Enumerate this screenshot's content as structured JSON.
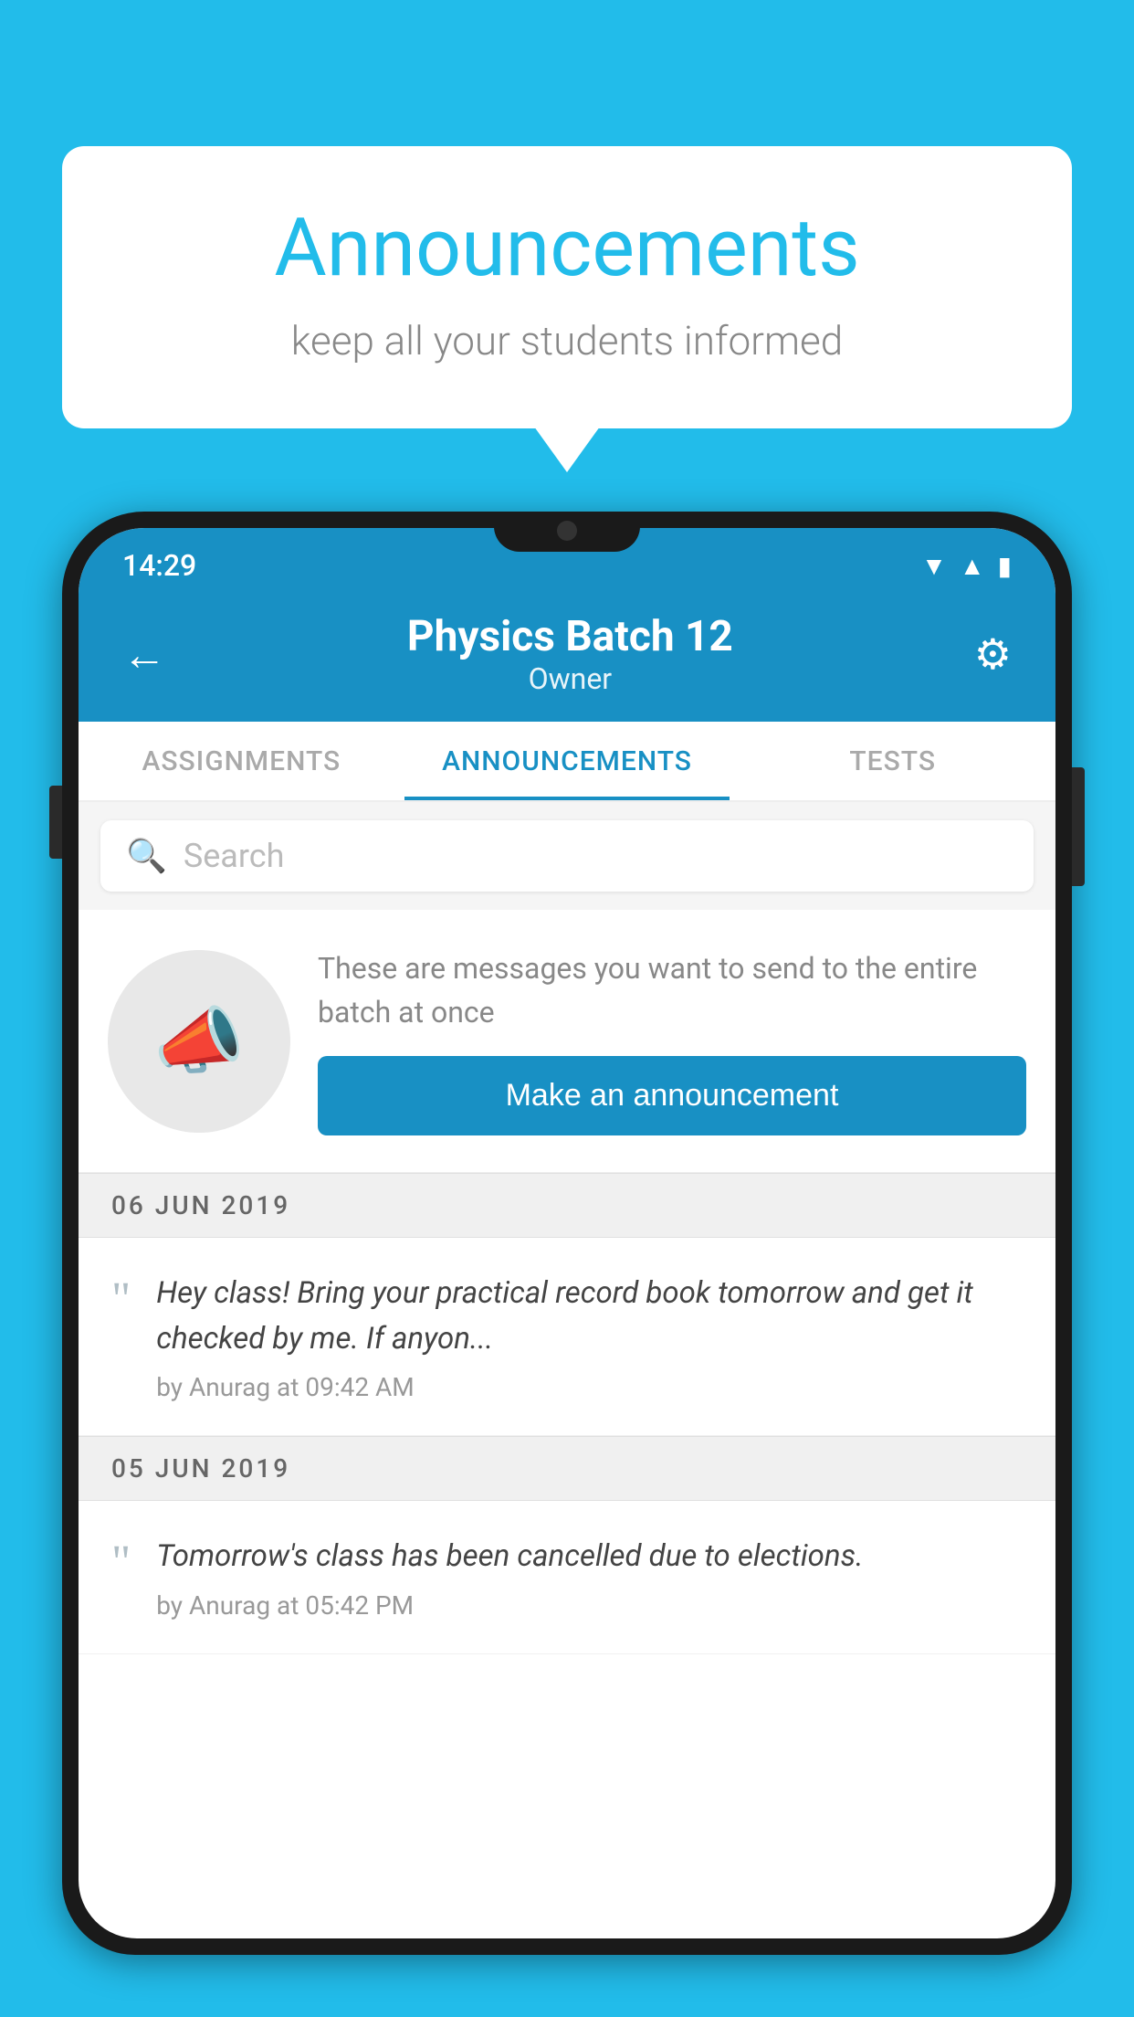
{
  "background_color": "#22BCEA",
  "speech_bubble": {
    "title": "Announcements",
    "subtitle": "keep all your students informed"
  },
  "status_bar": {
    "time": "14:29",
    "icons": [
      "wifi",
      "signal",
      "battery"
    ]
  },
  "app_header": {
    "title": "Physics Batch 12",
    "subtitle": "Owner",
    "back_label": "←",
    "settings_label": "⚙"
  },
  "tabs": [
    {
      "label": "ASSIGNMENTS",
      "active": false
    },
    {
      "label": "ANNOUNCEMENTS",
      "active": true
    },
    {
      "label": "TESTS",
      "active": false
    },
    {
      "label": "...",
      "active": false
    }
  ],
  "search": {
    "placeholder": "Search"
  },
  "promo": {
    "text": "These are messages you want to send to the entire batch at once",
    "button_label": "Make an announcement"
  },
  "announcements": [
    {
      "date": "06  JUN  2019",
      "text": "Hey class! Bring your practical record book tomorrow and get it checked by me. If anyon...",
      "meta": "by Anurag at 09:42 AM"
    },
    {
      "date": "05  JUN  2019",
      "text": "Tomorrow's class has been cancelled due to elections.",
      "meta": "by Anurag at 05:42 PM"
    }
  ]
}
